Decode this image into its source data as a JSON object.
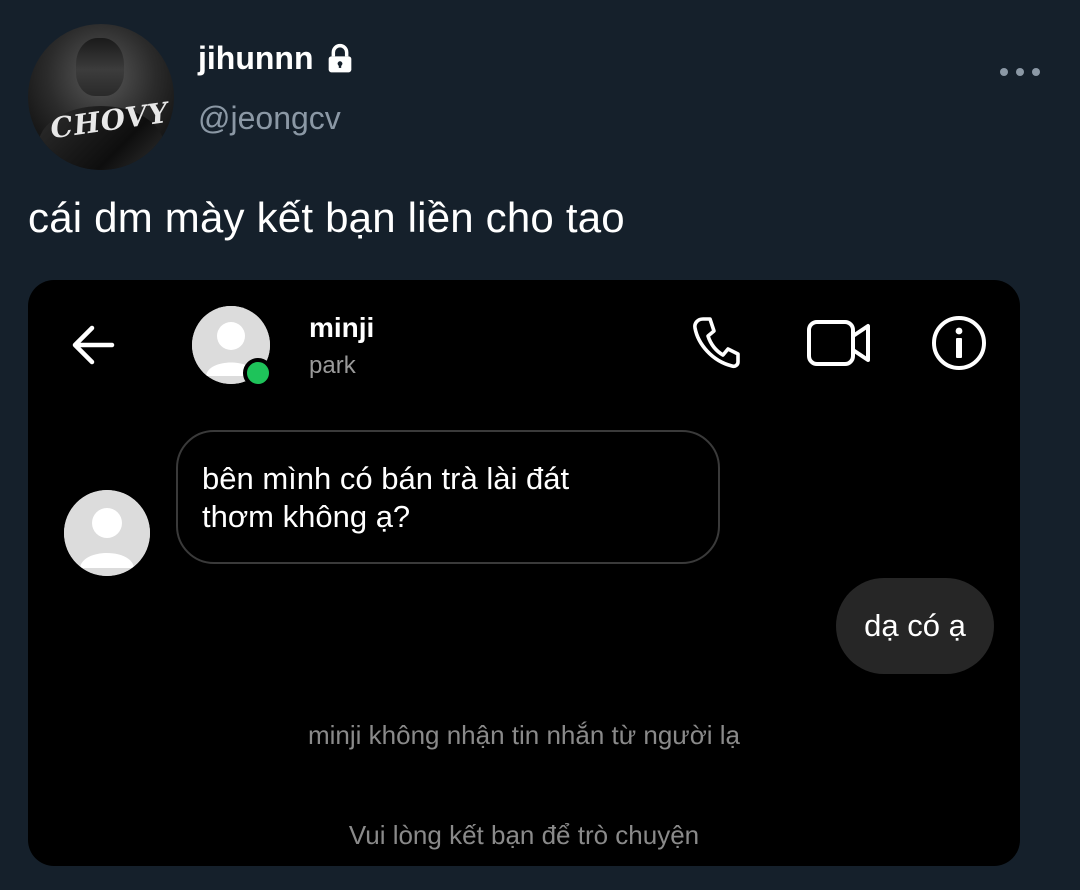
{
  "tweet": {
    "display_name": "jihunnn",
    "handle": "@jeongcv",
    "text": "cái dm mày kết bạn liền cho tao",
    "avatar_logo_text": "CHOVY",
    "verified_icon": "lock-icon",
    "more_icon": "more-icon"
  },
  "media": {
    "header": {
      "back_icon": "arrow-left-icon",
      "contact_name": "minji",
      "contact_subtitle": "park",
      "online_status_color": "#1ec35a",
      "actions": [
        {
          "name": "call",
          "icon": "phone-icon"
        },
        {
          "name": "video",
          "icon": "video-camera-icon"
        },
        {
          "name": "info",
          "icon": "info-icon"
        }
      ]
    },
    "messages": [
      {
        "direction": "incoming",
        "text": "bên mình có bán trà lài đát\nthơm không ạ?"
      },
      {
        "direction": "outgoing",
        "text": "dạ có ạ"
      }
    ],
    "notices": [
      "minji không nhận tin nhắn từ người lạ",
      "Vui lòng kết bạn để trò chuyện"
    ]
  },
  "colors": {
    "background": "#15202b",
    "secondary_text": "#8b98a5",
    "media_background": "#000000",
    "outgoing_bubble": "#262626",
    "online_dot": "#1ec35a"
  }
}
